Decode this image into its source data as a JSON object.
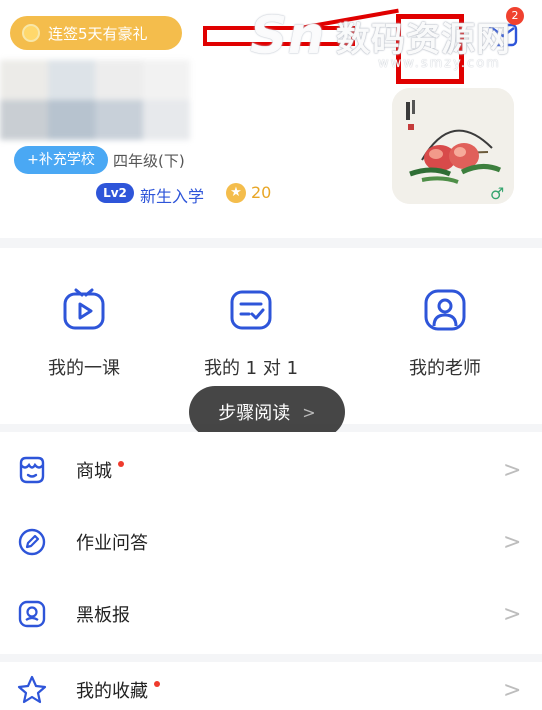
{
  "header": {
    "checkin_label": "连签5天有豪礼",
    "mail_badge": "2"
  },
  "watermark": {
    "logo": "Sn",
    "title": "数码资源网",
    "url": "www.smzy.com"
  },
  "profile": {
    "add_school_label": "+补充学校",
    "grade": "四年级(下)",
    "level_badge": "Lv2",
    "level_name": "新生入学",
    "star_glyph": "★",
    "points": "20",
    "gender_symbol": "♂"
  },
  "shortcuts": [
    {
      "label": "我的一课",
      "icon": "play-video-icon"
    },
    {
      "label": "我的 1 对 1",
      "icon": "checklist-icon"
    },
    {
      "label": "我的老师",
      "icon": "teacher-icon"
    }
  ],
  "toast": {
    "label": "步骤阅读",
    "arrow": ">"
  },
  "menu": {
    "items": [
      {
        "label": "商城",
        "icon": "shop-icon",
        "has_dot": true
      },
      {
        "label": "作业问答",
        "icon": "pencil-icon",
        "has_dot": false
      },
      {
        "label": "黑板报",
        "icon": "blackboard-icon",
        "has_dot": false
      },
      {
        "label": "我的收藏",
        "icon": "star-outline-icon",
        "has_dot": true
      }
    ],
    "chevron": ">"
  },
  "colors": {
    "accent_blue": "#2e55d9",
    "checkin_orange": "#f4bd4c",
    "school_blue": "#4aa8f4",
    "badge_red": "#f0412f",
    "annotation_red": "#e00000",
    "gender_green": "#36a56f"
  }
}
